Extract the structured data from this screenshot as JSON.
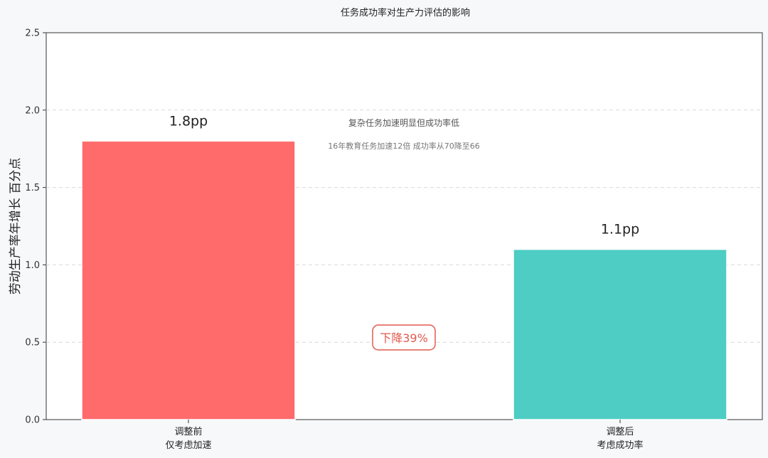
{
  "chart_data": {
    "type": "bar",
    "title": "任务成功率对生产力评估的影响",
    "ylabel": "劳动生产率年增长 百分点",
    "xlabel": "",
    "ylim": [
      0,
      2.5
    ],
    "yticks": [
      "0.0",
      "0.5",
      "1.0",
      "1.5",
      "2.0",
      "2.5"
    ],
    "grid": true,
    "categories": [
      {
        "line1": "调整前",
        "line2": "仅考虑加速"
      },
      {
        "line1": "调整后",
        "line2": "考虑成功率"
      }
    ],
    "values": [
      1.8,
      1.1
    ],
    "value_labels": [
      "1.8pp",
      "1.1pp"
    ],
    "colors": [
      "#ff6b6b",
      "#4ecdc4"
    ],
    "annotations": {
      "main": "复杂任务加速明显但成功率低",
      "sub": "16年教育任务加速12倍 成功率从70降至66",
      "badge": "下降39%",
      "badge_color": "#e05a4e"
    }
  }
}
